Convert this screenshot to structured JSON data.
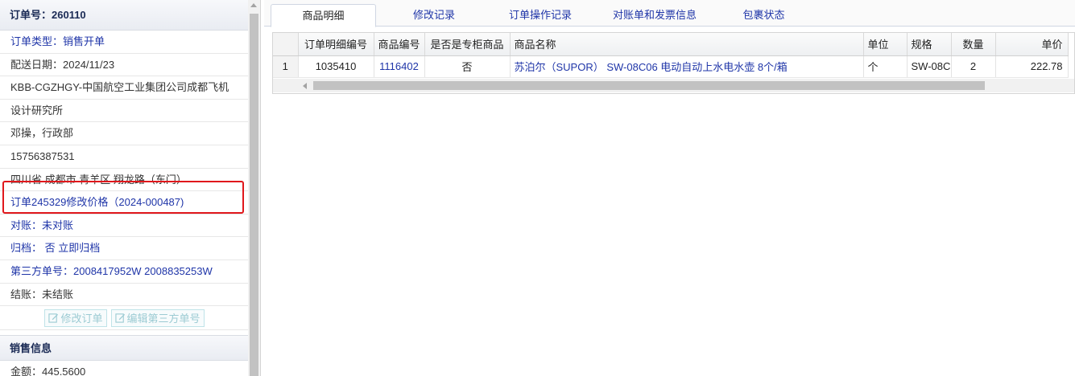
{
  "order": {
    "header": "订单号：260110",
    "rows": {
      "type": "订单类型：销售开单",
      "delivery_date": "配送日期：2024/11/23",
      "customer_line1": "KBB-CGZHGY-中国航空工业集团公司成都飞机",
      "customer_line2": "设计研究所",
      "contact": "邓操，行政部",
      "phone": "15756387531",
      "address": "四川省 成都市 青羊区 翔龙路（东门）",
      "price_change": "订单245329修改价格（2024-000487)",
      "reconcile_label": "对账：",
      "reconcile_value": "未对账",
      "archive_label": "归档：",
      "archive_value": " 否 立即归档",
      "third_party": "第三方单号：2008417952W 2008835253W",
      "settle_label": "结账：",
      "settle_value": "未结账"
    },
    "buttons": {
      "edit_order": "修改订单",
      "edit_third_party": "编辑第三方单号"
    }
  },
  "sales": {
    "header": "销售信息",
    "amount": "金额：445.5600"
  },
  "tabs": [
    {
      "label": "商品明细",
      "active": true
    },
    {
      "label": "修改记录",
      "active": false
    },
    {
      "label": "订单操作记录",
      "active": false
    },
    {
      "label": "对账单和发票信息",
      "active": false
    },
    {
      "label": "包裹状态",
      "active": false
    }
  ],
  "table": {
    "columns": [
      "订单明细编号",
      "商品编号",
      "是否是专柜商品",
      "商品名称",
      "单位",
      "规格",
      "数量",
      "单价"
    ],
    "rows": [
      {
        "index": "1",
        "detail_id": "1035410",
        "product_id": "1116402",
        "is_counter": "否",
        "name": "苏泊尔（SUPOR） SW-08C06 电动自动上水电水壶 8个/箱",
        "unit": "个",
        "spec": "SW-08C",
        "qty": "2",
        "price": "222.78"
      }
    ]
  },
  "colors": {
    "link": "#1f35a8",
    "highlight": "#e0181c"
  }
}
